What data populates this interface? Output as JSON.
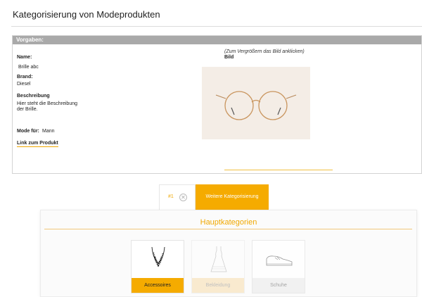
{
  "page": {
    "title": "Kategorisierung von Modeprodukten"
  },
  "vorgaben": {
    "header": "Vorgaben:",
    "name_label": "Name:",
    "name_value": "Brille abc",
    "brand_label": "Brand:",
    "brand_value": "Diesel",
    "description_label": "Beschreibung",
    "description_line1": "Hier steht die Beschreibung",
    "description_line2": "der Brille.",
    "mode_label": "Mode für:",
    "mode_value": "Mann",
    "link_label": "Link zum Produkt",
    "image_hint": "(Zum Vergrößern das Bild anklicken)",
    "image_label": "Bild"
  },
  "tabs": {
    "item_number": "#1",
    "close_symbol": "✕",
    "active_label": "Weitere Kategorisierung"
  },
  "hauptkategorien": {
    "title": "Hauptkategorien",
    "items": [
      {
        "label": "Accessoires",
        "state": "selected"
      },
      {
        "label": "Bekleidung",
        "state": "dimmed"
      },
      {
        "label": "Schuhe",
        "state": "unselected"
      }
    ]
  },
  "colors": {
    "accent": "#f5ab00",
    "panel_header": "#a9a9a9"
  }
}
